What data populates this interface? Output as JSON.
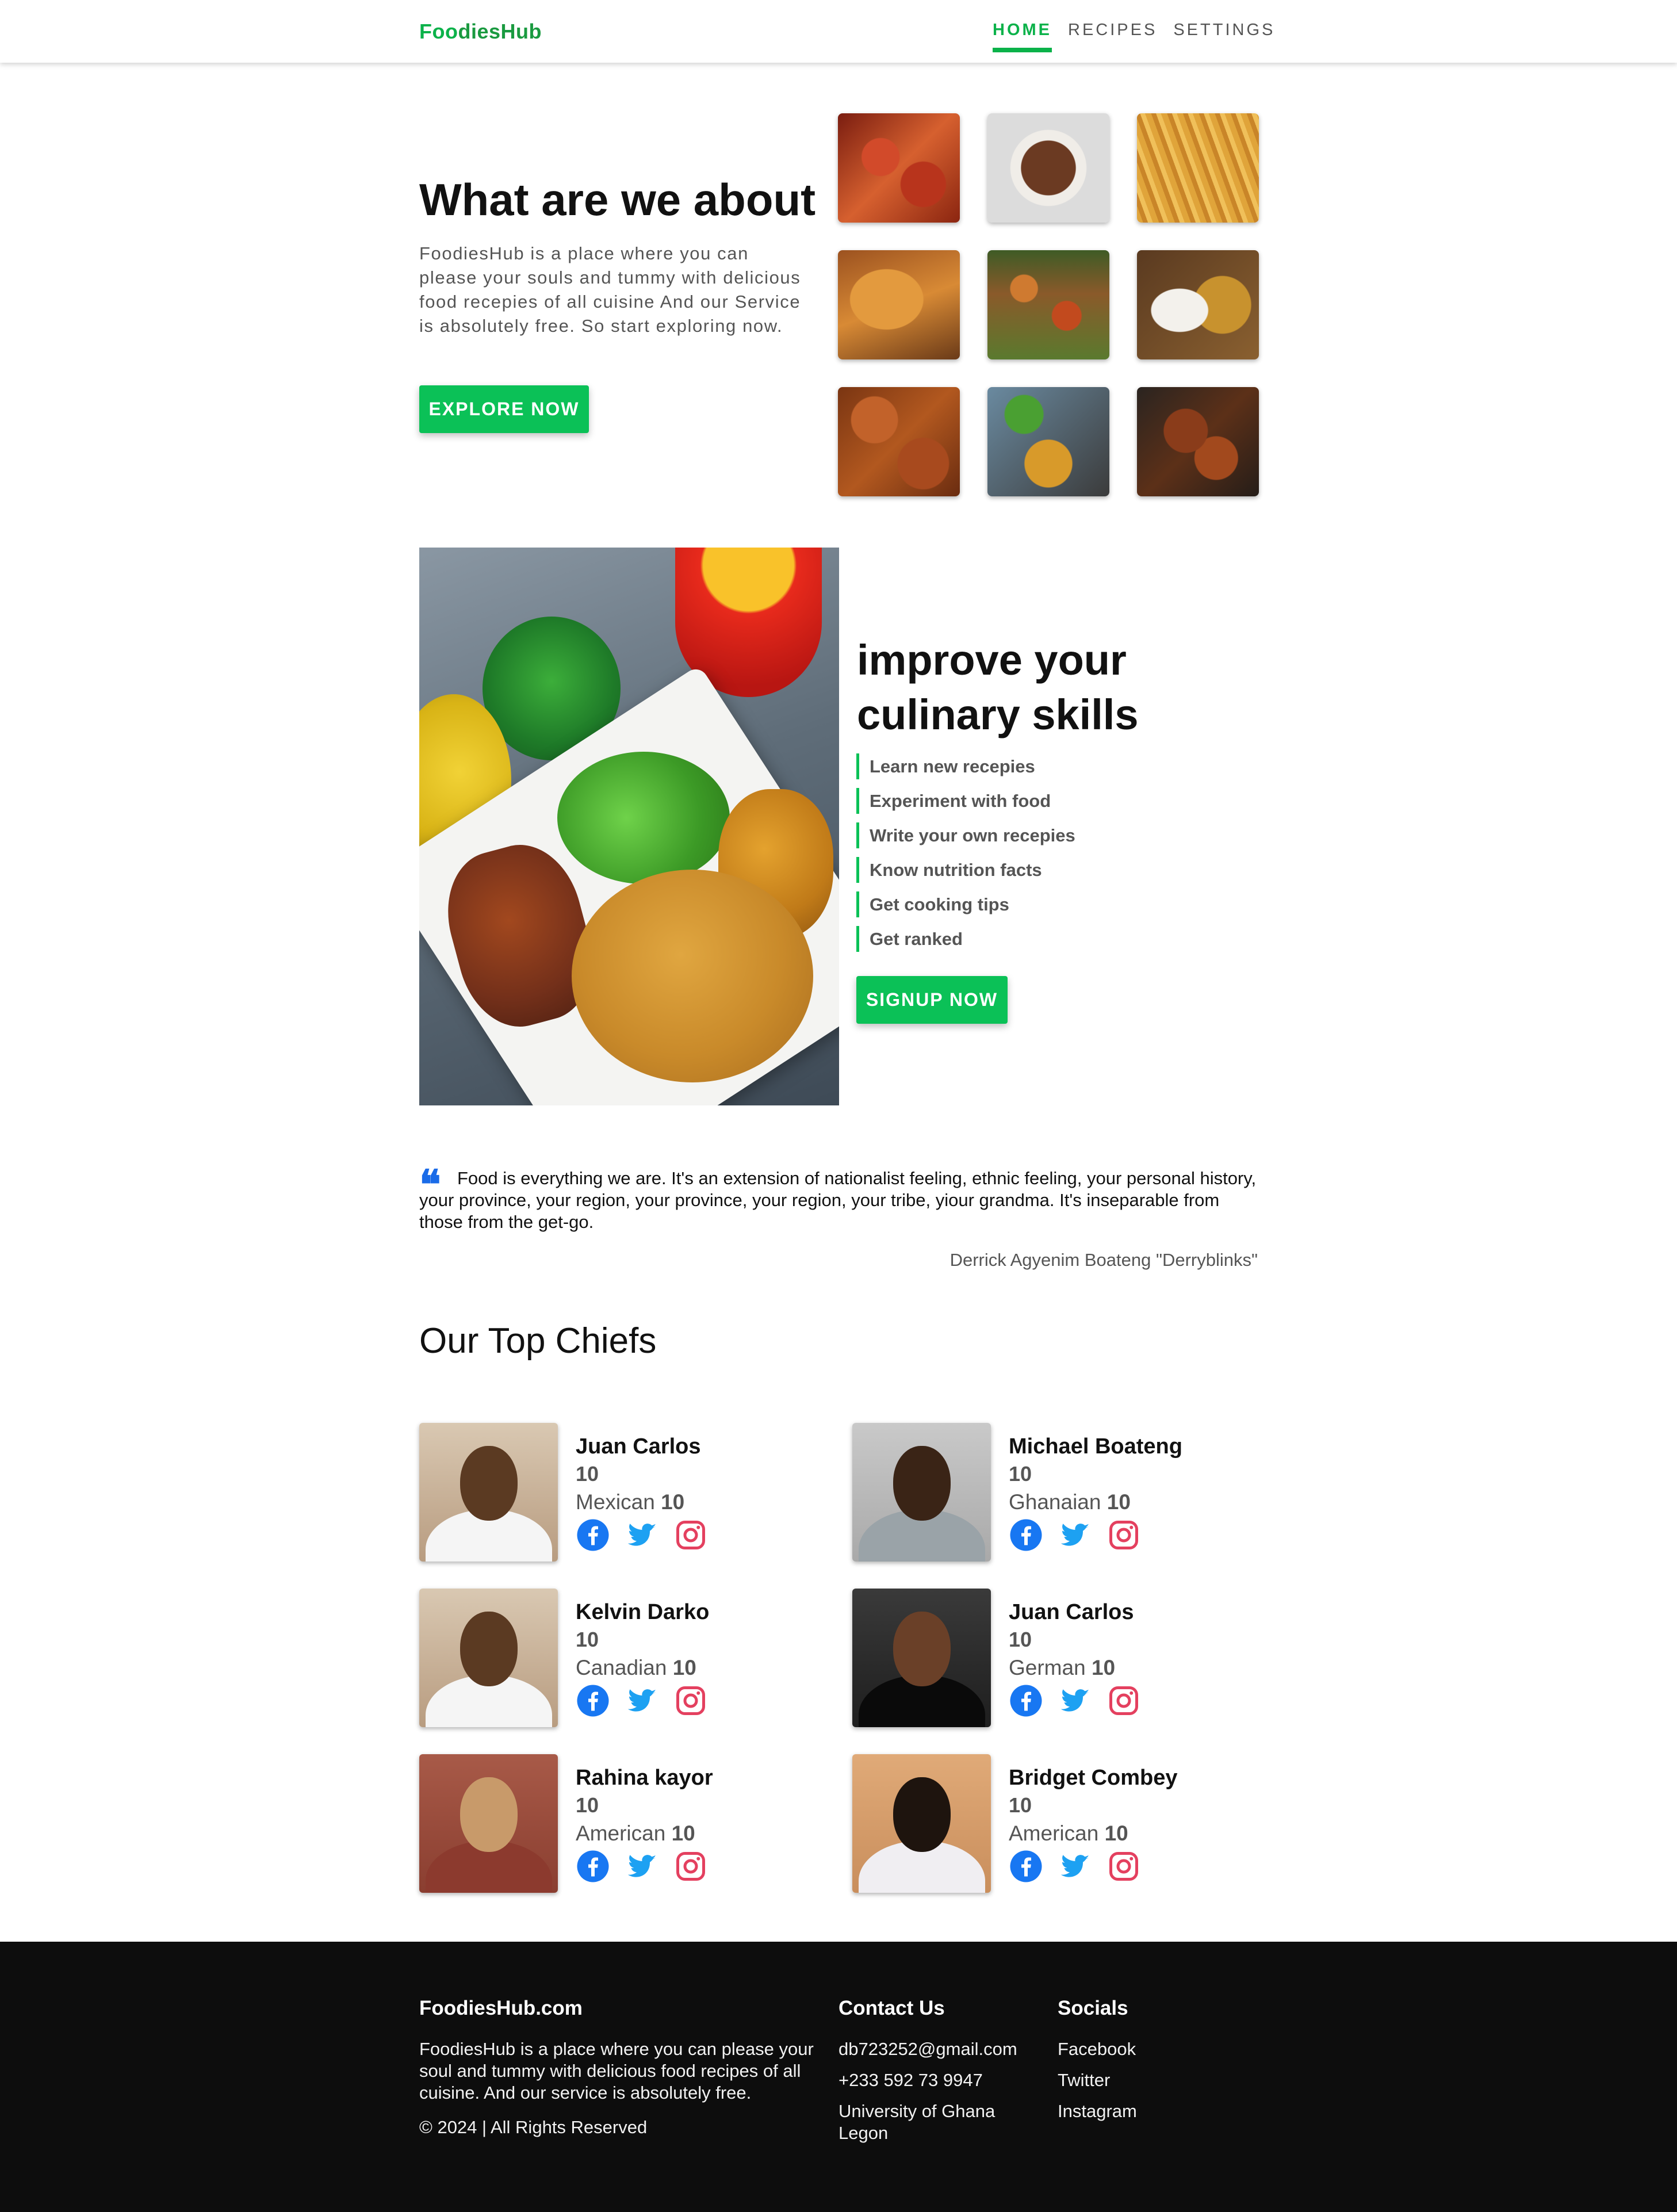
{
  "header": {
    "logo_part1": "Foo",
    "logo_part2": "diesHub",
    "nav": [
      {
        "label": "HOME",
        "active": true
      },
      {
        "label": "RECIPES",
        "active": false
      },
      {
        "label": "SETTINGS",
        "active": false
      }
    ]
  },
  "about": {
    "title": "What are we about",
    "text": "FoodiesHub is a place where you can please your souls and tummy with delicious food recepies of all cuisine And our Service is absolutely free. So start exploring now.",
    "button": "EXPLORE NOW"
  },
  "culinary": {
    "title": "improve your culinary skills",
    "skills": [
      "Learn new recepies",
      "Experiment with food",
      "Write your own recepies",
      "Know nutrition facts",
      "Get cooking tips",
      "Get ranked"
    ],
    "button": "SIGNUP NOW"
  },
  "quote": {
    "mark": "❝",
    "text": "Food is everything we are. It's an extension of nationalist feeling, ethnic feeling, your personal history, your province, your region, your province, your region, your tribe, yiour grandma. It's inseparable from those from the get-go.",
    "author": "Derrick Agyenim Boateng \"Derryblinks\""
  },
  "chefs": {
    "title": "Our Top Chiefs",
    "list": [
      {
        "name": "Juan Carlos",
        "score": "10",
        "cuisine": "Mexican",
        "cuisine_score": "10"
      },
      {
        "name": "Michael Boateng",
        "score": "10",
        "cuisine": "Ghanaian",
        "cuisine_score": "10"
      },
      {
        "name": "Kelvin Darko",
        "score": "10",
        "cuisine": "Canadian",
        "cuisine_score": "10"
      },
      {
        "name": "Juan Carlos",
        "score": "10",
        "cuisine": "German",
        "cuisine_score": "10"
      },
      {
        "name": "Rahina kayor",
        "score": "10",
        "cuisine": "American",
        "cuisine_score": "10"
      },
      {
        "name": "Bridget Combey",
        "score": "10",
        "cuisine": "American",
        "cuisine_score": "10"
      }
    ]
  },
  "footer": {
    "brand": "FoodiesHub.com",
    "description": "FoodiesHub is a place where you can please your soul and tummy with delicious food recipes of all cuisine. And our service is absolutely free.",
    "copyright": "© 2024 | All Rights Reserved",
    "contact_title": "Contact Us",
    "email": "db723252@gmail.com",
    "phone": "+233 592 73 9947",
    "address": "University of Ghana Legon",
    "socials_title": "Socials",
    "socials": [
      "Facebook",
      "Twitter",
      "Instagram"
    ]
  },
  "colors": {
    "brand_green": "#0bc157",
    "facebook": "#1877f2",
    "twitter": "#1da1f2",
    "instagram": "#e4405f",
    "footer_bg": "#0d0d0d"
  }
}
